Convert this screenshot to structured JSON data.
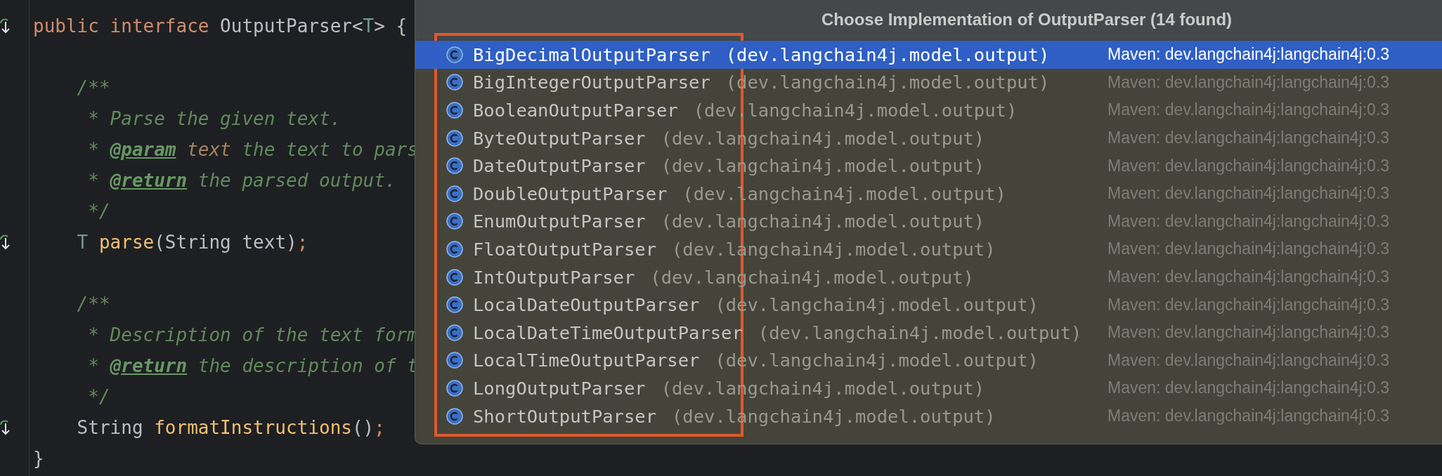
{
  "editor": {
    "lines": [
      {
        "implemented": true,
        "tokens": [
          {
            "text": "public interface ",
            "kind": "keyword"
          },
          {
            "text": "OutputParser<",
            "kind": "plain"
          },
          {
            "text": "T",
            "kind": "typeparam"
          },
          {
            "text": "> {",
            "kind": "plain"
          }
        ]
      },
      {
        "implemented": false
      },
      {
        "implemented": false,
        "tokens": [
          {
            "text": "    /**",
            "kind": "comment"
          }
        ]
      },
      {
        "implemented": false,
        "tokens": [
          {
            "text": "     * Parse the given text.",
            "kind": "comment"
          }
        ]
      },
      {
        "implemented": false,
        "tokens": [
          {
            "text": "     * ",
            "kind": "comment"
          },
          {
            "text": "@param",
            "kind": "doctag"
          },
          {
            "text": " text",
            "kind": "param"
          },
          {
            "text": " the text to pars",
            "kind": "comment"
          }
        ]
      },
      {
        "implemented": false,
        "tokens": [
          {
            "text": "     * ",
            "kind": "comment"
          },
          {
            "text": "@return",
            "kind": "doctag"
          },
          {
            "text": " the parsed output.",
            "kind": "comment"
          }
        ]
      },
      {
        "implemented": false,
        "tokens": [
          {
            "text": "     */",
            "kind": "comment"
          }
        ]
      },
      {
        "implemented": true,
        "tokens": [
          {
            "text": "    T",
            "kind": "typeparam"
          },
          {
            "text": " parse",
            "kind": "method"
          },
          {
            "text": "(String text)",
            "kind": "plain"
          },
          {
            "text": ";",
            "kind": "keyword"
          }
        ]
      },
      {
        "implemented": false
      },
      {
        "implemented": false,
        "tokens": [
          {
            "text": "    /**",
            "kind": "comment"
          }
        ]
      },
      {
        "implemented": false,
        "tokens": [
          {
            "text": "     * Description of the text form",
            "kind": "comment"
          }
        ]
      },
      {
        "implemented": false,
        "tokens": [
          {
            "text": "     * ",
            "kind": "comment"
          },
          {
            "text": "@return",
            "kind": "doctag"
          },
          {
            "text": " the description of t",
            "kind": "comment"
          }
        ]
      },
      {
        "implemented": false,
        "tokens": [
          {
            "text": "     */",
            "kind": "comment"
          }
        ]
      },
      {
        "implemented": true,
        "tokens": [
          {
            "text": "    String ",
            "kind": "plain"
          },
          {
            "text": "formatInstructions",
            "kind": "method"
          },
          {
            "text": "()",
            "kind": "plain"
          },
          {
            "text": ";",
            "kind": "keyword"
          }
        ]
      },
      {
        "implemented": false,
        "tokens": [
          {
            "text": "}",
            "kind": "plain"
          }
        ]
      }
    ]
  },
  "popup": {
    "title": "Choose Implementation of OutputParser (14 found)",
    "highlight_frame": true,
    "items": [
      {
        "name": "BigDecimalOutputParser",
        "package": "(dev.langchain4j.model.output)",
        "module": "Maven: dev.langchain4j:langchain4j:0.3",
        "selected": true
      },
      {
        "name": "BigIntegerOutputParser",
        "package": "(dev.langchain4j.model.output)",
        "module": "Maven: dev.langchain4j:langchain4j:0.3",
        "selected": false
      },
      {
        "name": "BooleanOutputParser",
        "package": "(dev.langchain4j.model.output)",
        "module": "Maven: dev.langchain4j:langchain4j:0.3",
        "selected": false
      },
      {
        "name": "ByteOutputParser",
        "package": "(dev.langchain4j.model.output)",
        "module": "Maven: dev.langchain4j:langchain4j:0.3",
        "selected": false
      },
      {
        "name": "DateOutputParser",
        "package": "(dev.langchain4j.model.output)",
        "module": "Maven: dev.langchain4j:langchain4j:0.3",
        "selected": false
      },
      {
        "name": "DoubleOutputParser",
        "package": "(dev.langchain4j.model.output)",
        "module": "Maven: dev.langchain4j:langchain4j:0.3",
        "selected": false
      },
      {
        "name": "EnumOutputParser",
        "package": "(dev.langchain4j.model.output)",
        "module": "Maven: dev.langchain4j:langchain4j:0.3",
        "selected": false
      },
      {
        "name": "FloatOutputParser",
        "package": "(dev.langchain4j.model.output)",
        "module": "Maven: dev.langchain4j:langchain4j:0.3",
        "selected": false
      },
      {
        "name": "IntOutputParser",
        "package": "(dev.langchain4j.model.output)",
        "module": "Maven: dev.langchain4j:langchain4j:0.3",
        "selected": false
      },
      {
        "name": "LocalDateOutputParser",
        "package": "(dev.langchain4j.model.output)",
        "module": "Maven: dev.langchain4j:langchain4j:0.3",
        "selected": false
      },
      {
        "name": "LocalDateTimeOutputParser",
        "package": "(dev.langchain4j.model.output)",
        "module": "Maven: dev.langchain4j:langchain4j:0.3",
        "selected": false
      },
      {
        "name": "LocalTimeOutputParser",
        "package": "(dev.langchain4j.model.output)",
        "module": "Maven: dev.langchain4j:langchain4j:0.3",
        "selected": false
      },
      {
        "name": "LongOutputParser",
        "package": "(dev.langchain4j.model.output)",
        "module": "Maven: dev.langchain4j:langchain4j:0.3",
        "selected": false
      },
      {
        "name": "ShortOutputParser",
        "package": "(dev.langchain4j.model.output)",
        "module": "Maven: dev.langchain4j:langchain4j:0.3",
        "selected": false
      }
    ]
  }
}
